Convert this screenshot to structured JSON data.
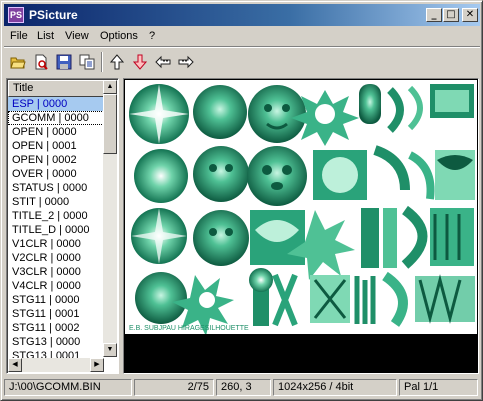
{
  "window": {
    "title": "PSicture",
    "icon": "app-logo-icon"
  },
  "titlebar_buttons": {
    "minimize": "_",
    "maximize": "□",
    "close": "✕"
  },
  "menu": [
    "File",
    "List",
    "View",
    "Options",
    "?"
  ],
  "toolbar": [
    "open-folder-icon",
    "open-file-icon",
    "save-icon",
    "copy-icon",
    "arrow-up-icon",
    "arrow-down-icon",
    "previous-icon",
    "next-icon"
  ],
  "list": {
    "header": "Title",
    "selected_index": 0,
    "focused_index": 1,
    "items": [
      "ESP | 0000",
      "GCOMM | 0000",
      "OPEN | 0000",
      "OPEN | 0001",
      "OPEN | 0002",
      "OVER | 0000",
      "STATUS | 0000",
      "STIT | 0000",
      "TITLE_2 | 0000",
      "TITLE_D | 0000",
      "V1CLR | 0000",
      "V2CLR | 0000",
      "V3CLR | 0000",
      "V4CLR | 0000",
      "STG11 | 0000",
      "STG11 | 0001",
      "STG11 | 0002",
      "STG13 | 0000",
      "STG13 | 0001"
    ]
  },
  "status": {
    "path": "J:\\00\\GCOMM.BIN",
    "index": "2/75",
    "coords": "260, 3",
    "size": "1024x256 / 4bit",
    "palette": "Pal 1/1"
  },
  "colors": {
    "sprite": "#1f8f68",
    "sprite_dark": "#0d5a40",
    "sprite_light": "#7fd9b4",
    "selection": "#a6caf0"
  }
}
